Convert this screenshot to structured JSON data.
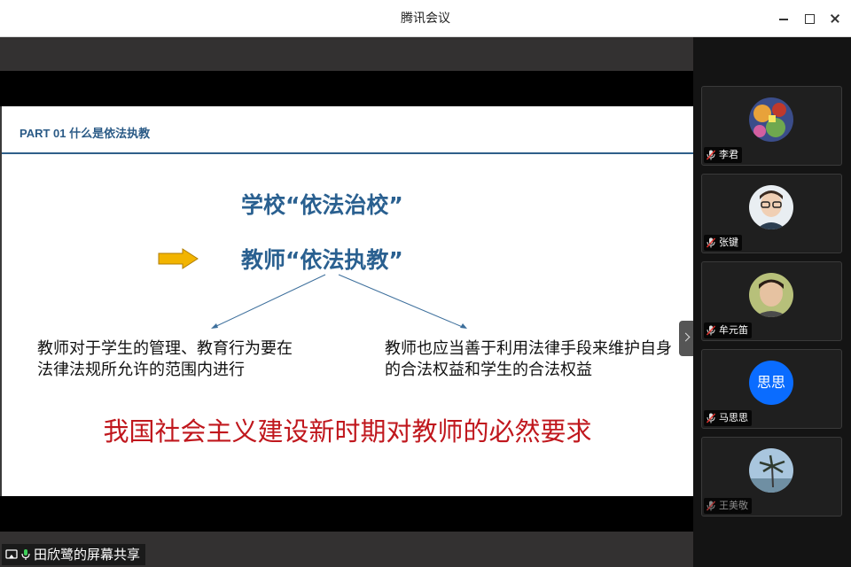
{
  "window": {
    "title": "腾讯会议"
  },
  "slide": {
    "header": "PART 01  什么是依法执教",
    "line1": "学校“依法治校”",
    "line2": "教师“依法执教”",
    "left_text": "教师对于学生的管理、教育行为要在法律法规所允许的范围内进行",
    "right_text": "教师也应当善于利用法律手段来维护自身的合法权益和学生的合法权益",
    "conclusion": "我国社会主义建设新时期对教师的必然要求",
    "colors": {
      "heading": "#2a6090",
      "conclusion": "#c0171d",
      "arrow": "#f2b400"
    }
  },
  "share_label": "田欣鹭的屏幕共享",
  "participants": [
    {
      "name": "李君",
      "avatar": "photo-colorful"
    },
    {
      "name": "张键",
      "avatar": "photo-glasses"
    },
    {
      "name": "牟元笛",
      "avatar": "photo-portrait"
    },
    {
      "name": "马思思",
      "avatar_text": "思思",
      "avatar_color": "#0a6cff"
    },
    {
      "name": "王美敬",
      "avatar": "photo-palm-tree",
      "dimmed": true
    }
  ],
  "icons": {
    "mic_muted": "mic-muted-icon",
    "mic": "mic-icon",
    "screen_share": "screen-share-icon",
    "collapse": "chevron-right-icon"
  }
}
